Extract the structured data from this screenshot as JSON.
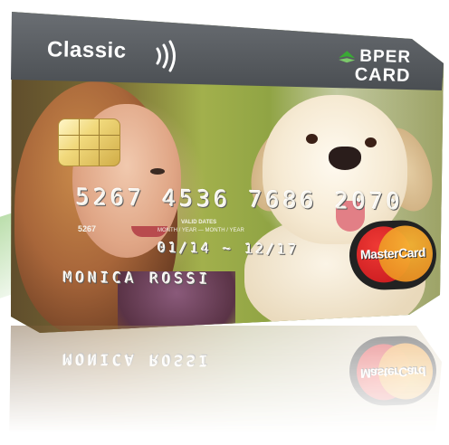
{
  "card": {
    "product": "Classic",
    "brand_line1": "BPER",
    "brand_line2": "CARD",
    "number": "5267 4536 7686 2070",
    "number_short": "5267",
    "valid_label": "VALID DATES",
    "valid_sub": "MONTH / YEAR — MONTH / YEAR",
    "valid_dates": "01/14 ~ 12/17",
    "holder": "MONICA ROSSI",
    "network": "MasterCard"
  },
  "colors": {
    "header": "#55595d",
    "brand_green": "#3aa935",
    "mc_red": "#eb001b",
    "mc_yellow": "#f79e1b"
  },
  "icons": [
    "contactless-icon",
    "bper-logo-icon",
    "chip-icon",
    "mastercard-logo-icon"
  ]
}
